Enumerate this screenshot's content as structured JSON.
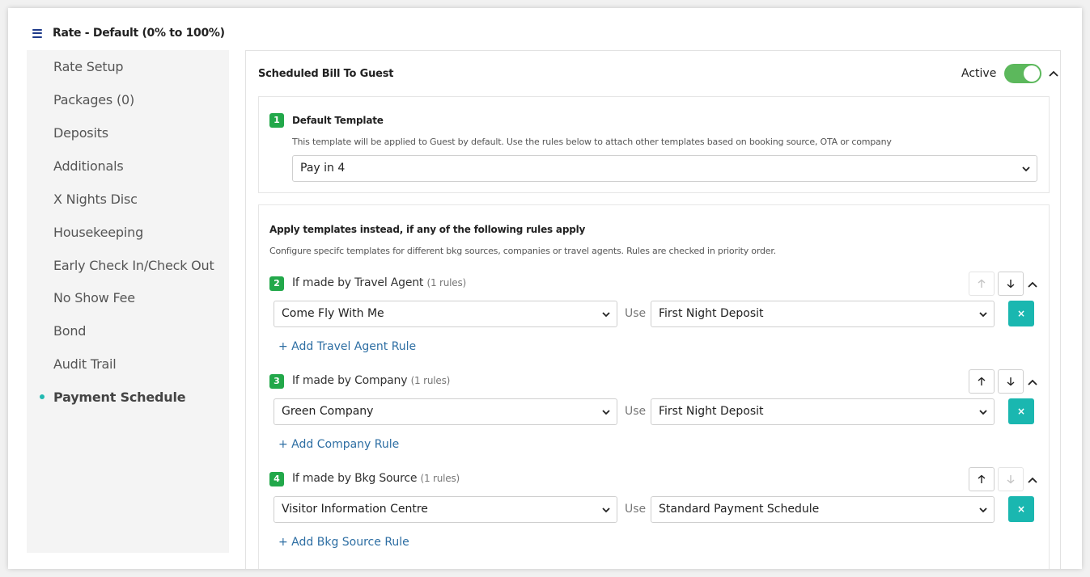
{
  "header": {
    "title": "Rate - Default (0% to 100%)",
    "menu_icon": "hamburger-menu-icon"
  },
  "sidebar": {
    "items": [
      {
        "label": "Rate Setup"
      },
      {
        "label": "Packages (0)"
      },
      {
        "label": "Deposits"
      },
      {
        "label": "Additionals"
      },
      {
        "label": "X Nights Disc"
      },
      {
        "label": "Housekeeping"
      },
      {
        "label": "Early Check In/Check Out"
      },
      {
        "label": "No Show Fee"
      },
      {
        "label": "Bond"
      },
      {
        "label": "Audit Trail"
      },
      {
        "label": "Payment Schedule",
        "active": true
      }
    ]
  },
  "section": {
    "title": "Scheduled Bill To Guest",
    "active_label": "Active",
    "active": true
  },
  "default_template": {
    "number": "1",
    "label": "Default Template",
    "help": "This template will be applied to Guest by default. Use the rules below to attach other templates based on booking source, OTA or company",
    "value": "Pay in 4"
  },
  "rules_block": {
    "title": "Apply templates instead, if any of the following rules apply",
    "help": "Configure specifc templates for different bkg sources, companies or travel agents. Rules are checked in priority order."
  },
  "use_label": "Use",
  "remove_symbol": "×",
  "rules": [
    {
      "number": "2",
      "label": "If made by Travel Agent",
      "count": "(1 rules)",
      "source": "Come Fly With Me",
      "template": "First Night Deposit",
      "add_label": "+ Add Travel Agent Rule",
      "up_enabled": false,
      "down_enabled": true
    },
    {
      "number": "3",
      "label": "If made by Company",
      "count": "(1 rules)",
      "source": "Green Company",
      "template": "First Night Deposit",
      "add_label": "+ Add Company Rule",
      "up_enabled": true,
      "down_enabled": true
    },
    {
      "number": "4",
      "label": "If made by Bkg Source",
      "count": "(1 rules)",
      "source": "Visitor Information Centre",
      "template": "Standard Payment Schedule",
      "add_label": "+ Add Bkg Source Rule",
      "up_enabled": true,
      "down_enabled": false
    }
  ],
  "colors": {
    "accent_teal": "#1ab7b0",
    "badge_green": "#22a84a",
    "toggle_green": "#5cb85c",
    "link_blue": "#2d6ea3"
  }
}
